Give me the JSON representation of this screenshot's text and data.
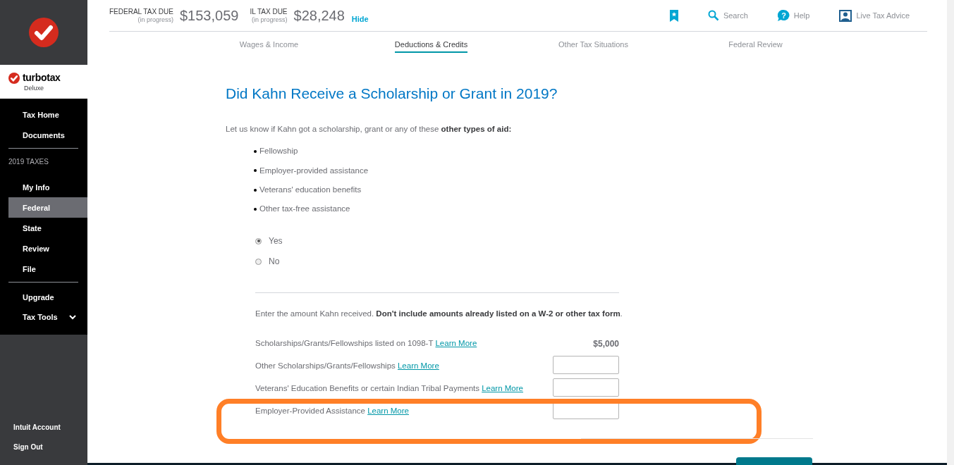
{
  "sidebar": {
    "brand": {
      "name": "turbotax",
      "edition": "Deluxe"
    },
    "items": [
      {
        "kind": "item",
        "label": "Tax Home",
        "selected": false
      },
      {
        "kind": "item",
        "label": "Documents",
        "selected": false
      },
      {
        "kind": "divider"
      },
      {
        "kind": "heading",
        "label": "2019 TAXES"
      },
      {
        "kind": "item",
        "label": "My Info",
        "selected": false
      },
      {
        "kind": "item",
        "label": "Federal",
        "selected": true
      },
      {
        "kind": "item",
        "label": "State",
        "selected": false
      },
      {
        "kind": "item",
        "label": "Review",
        "selected": false
      },
      {
        "kind": "item",
        "label": "File",
        "selected": false
      },
      {
        "kind": "divider"
      },
      {
        "kind": "item",
        "label": "Upgrade",
        "selected": false
      },
      {
        "kind": "menu",
        "label": "Tax Tools",
        "expanded": false
      }
    ],
    "footer": [
      "Intuit Account",
      "Sign Out"
    ]
  },
  "header": {
    "taxes": [
      {
        "label": "FEDERAL TAX DUE",
        "note": "(in progress)",
        "amount": "$153,059"
      },
      {
        "label": "IL TAX DUE",
        "note": "(in progress)",
        "amount": "$28,248"
      }
    ],
    "hide_link": "Hide",
    "tools": [
      {
        "kind": "bookmark"
      },
      {
        "kind": "search",
        "label": "Search"
      },
      {
        "kind": "help",
        "glyph": "?",
        "label": "Help"
      },
      {
        "kind": "advice",
        "label": "Live Tax Advice"
      }
    ]
  },
  "tabs": [
    {
      "label": "Wages & Income",
      "selected": false
    },
    {
      "label": "Deductions & Credits",
      "selected": true
    },
    {
      "label": "Other Tax Situations",
      "selected": false
    },
    {
      "label": "Federal Review",
      "selected": false
    }
  ],
  "page": {
    "title": "Did Kahn Receive a Scholarship or Grant in 2019?",
    "intro": "Let us know if Kahn got a scholarship, grant or any of these **other types of aid:**",
    "aid_types": [
      "Fellowship",
      "Employer-provided assistance",
      "Veterans' education benefits",
      "Other tax-free assistance"
    ],
    "options": [
      {
        "label": "Yes",
        "selected": true
      },
      {
        "label": "No",
        "selected": false
      }
    ],
    "instruction": "Enter the amount Kahn received. **Don't include amounts already listed on a W-2 or other tax form**.",
    "amounts": [
      {
        "label": "Scholarships/Grants/Fellowships listed on 1098-T",
        "link": "Learn More",
        "value": "$5,000",
        "kind": "fixed"
      },
      {
        "label": "Other Scholarships/Grants/Fellowships",
        "link": "Learn More",
        "kind": "input"
      },
      {
        "label": "Veterans' Education Benefits or certain Indian Tribal Payments",
        "link": "Learn More",
        "kind": "input"
      },
      {
        "label": "Employer-Provided Assistance",
        "link": "Learn More",
        "kind": "input",
        "highlighted": true
      }
    ]
  }
}
